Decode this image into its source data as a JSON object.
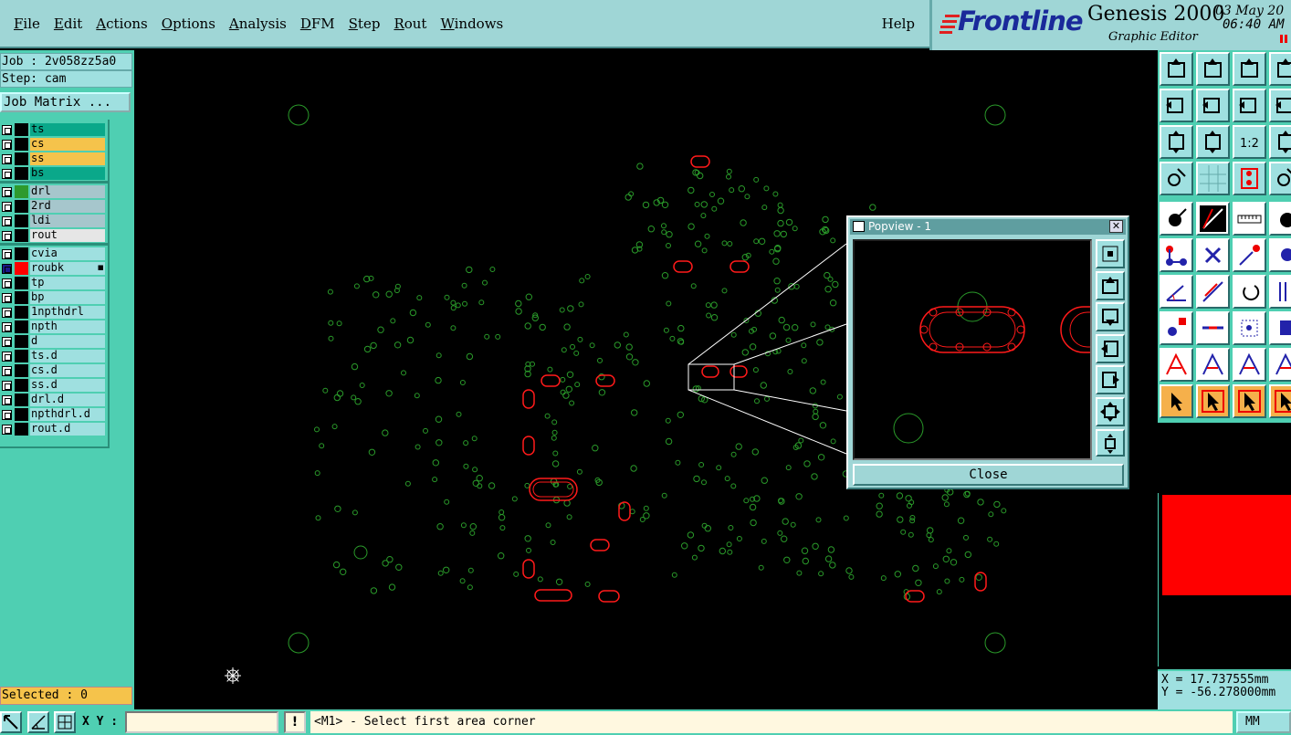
{
  "menu": [
    "File",
    "Edit",
    "Actions",
    "Options",
    "Analysis",
    "DFM",
    "Step",
    "Rout",
    "Windows"
  ],
  "help_label": "Help",
  "brand": {
    "logo": "Frontline",
    "product": "Genesis 2000",
    "subtitle": "Graphic Editor",
    "date": "03 May 20",
    "time": "06:40 AM"
  },
  "job": {
    "job_line": "Job : 2v058zz5a0",
    "step_line": "Step: cam",
    "matrix_button": "Job Matrix ..."
  },
  "layers": [
    {
      "name": "ts",
      "color": "#0aa88a",
      "swatch": "#000000",
      "group": 0
    },
    {
      "name": "cs",
      "color": "#f5c34b",
      "swatch": "#000000",
      "group": 0
    },
    {
      "name": "ss",
      "color": "#f5c34b",
      "swatch": "#000000",
      "group": 0
    },
    {
      "name": "bs",
      "color": "#0aa88a",
      "swatch": "#000000",
      "group": 0
    },
    {
      "name": "drl",
      "color": "#a6c6cc",
      "swatch": "#2e9a2e",
      "group": 1
    },
    {
      "name": "2rd",
      "color": "#a6c6cc",
      "swatch": "#000000",
      "group": 1
    },
    {
      "name": "ldi",
      "color": "#a6c6cc",
      "swatch": "#000000",
      "group": 1
    },
    {
      "name": "rout",
      "color": "#e6e6e6",
      "swatch": "#000000",
      "group": 1
    },
    {
      "name": "cvia",
      "color": "#9fe0e0",
      "swatch": "#000000",
      "group": 2
    },
    {
      "name": "roubk",
      "color": "#9fe0e0",
      "swatch": "#ff0000",
      "group": 2,
      "active": true
    },
    {
      "name": "tp",
      "color": "#9fe0e0",
      "swatch": "#000000",
      "group": 2
    },
    {
      "name": "bp",
      "color": "#9fe0e0",
      "swatch": "#000000",
      "group": 2
    },
    {
      "name": "1npthdrl",
      "color": "#9fe0e0",
      "swatch": "#000000",
      "group": 2
    },
    {
      "name": "npth",
      "color": "#9fe0e0",
      "swatch": "#000000",
      "group": 2
    },
    {
      "name": "d",
      "color": "#9fe0e0",
      "swatch": "#000000",
      "group": 2
    },
    {
      "name": "ts.d",
      "color": "#9fe0e0",
      "swatch": "#000000",
      "group": 2
    },
    {
      "name": "cs.d",
      "color": "#9fe0e0",
      "swatch": "#000000",
      "group": 2
    },
    {
      "name": "ss.d",
      "color": "#9fe0e0",
      "swatch": "#000000",
      "group": 2
    },
    {
      "name": "drl.d",
      "color": "#9fe0e0",
      "swatch": "#000000",
      "group": 2
    },
    {
      "name": "npthdrl.d",
      "color": "#9fe0e0",
      "swatch": "#000000",
      "group": 2
    },
    {
      "name": "rout.d",
      "color": "#9fe0e0",
      "swatch": "#000000",
      "group": 2
    }
  ],
  "selected": "Selected : 0",
  "popview": {
    "title": "Popview - 1",
    "close_label": "Close"
  },
  "coords": {
    "x": "X = 17.737555mm",
    "y": "Y = -56.278000mm"
  },
  "bottom": {
    "xy_label": "X Y :",
    "xy_value": "",
    "warn": "!",
    "status": "<M1> - Select first area corner",
    "units": "MM"
  },
  "colors": {
    "drill": "#2a9a2a",
    "rout": "#ff1a1a",
    "panel": "#4fcfb2",
    "button": "#9fe0e0"
  }
}
